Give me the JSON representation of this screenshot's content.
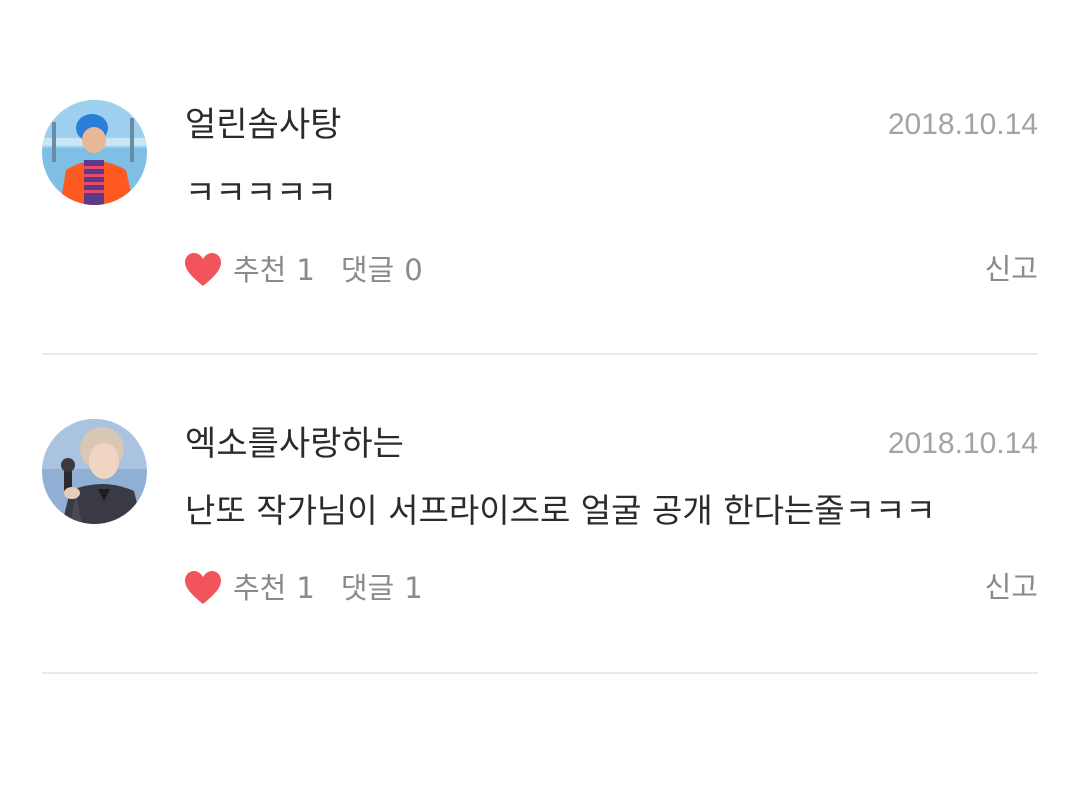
{
  "comments": [
    {
      "username": "얼린솜사탕",
      "date": "2018.10.14",
      "text": "ㅋㅋㅋㅋㅋ",
      "recommend_label": "추천",
      "recommend_count": "1",
      "reply_label": "댓글",
      "reply_count": "0",
      "report_label": "신고",
      "avatar": "user-avatar-photo"
    },
    {
      "username": "엑소를사랑하는",
      "date": "2018.10.14",
      "text": "난또 작가님이 서프라이즈로 얼굴 공개 한다는줄ㅋㅋㅋ",
      "recommend_label": "추천",
      "recommend_count": "1",
      "reply_label": "댓글",
      "reply_count": "1",
      "report_label": "신고",
      "avatar": "user-avatar-photo"
    }
  ],
  "colors": {
    "heart": "#f2545b",
    "text_primary": "#2b2b2b",
    "text_secondary": "#8a8a8a",
    "date": "#a3a3a3",
    "divider": "#e9e9e9"
  },
  "icons": {
    "like": "heart-icon"
  }
}
